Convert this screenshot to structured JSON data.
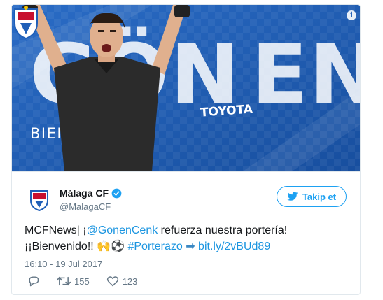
{
  "media": {
    "big_text_left": "GÖN",
    "big_text_right": "EN",
    "welcome": "BIENVENIDO",
    "sponsor": "TOYOTA",
    "info_icon": "info-icon",
    "colors": {
      "background": "#1f5fb8",
      "stripe": "#3a7bd5",
      "jersey": "#2b2b2b"
    }
  },
  "tweet": {
    "name": "Málaga CF",
    "handle": "@MalagaCF",
    "verified_icon": "verified-badge-icon",
    "follow_label": "Takip et",
    "text_prefix": "MCFNews| ¡",
    "mention": "@GonenCenk",
    "text_mid": " refuerza nuestra portería!",
    "line2_prefix": "¡¡Bienvenido!! ",
    "emojis": "🙌⚽",
    "hashtag": "#Porterazo",
    "arrow_emoji": "➡",
    "url": "bit.ly/2vBUd89",
    "timestamp": "16:10 - 19 Jul 2017",
    "retweet_count": "155",
    "like_count": "123"
  },
  "colors": {
    "accent": "#1da1f2",
    "link": "#1b95e0",
    "muted": "#657786"
  }
}
